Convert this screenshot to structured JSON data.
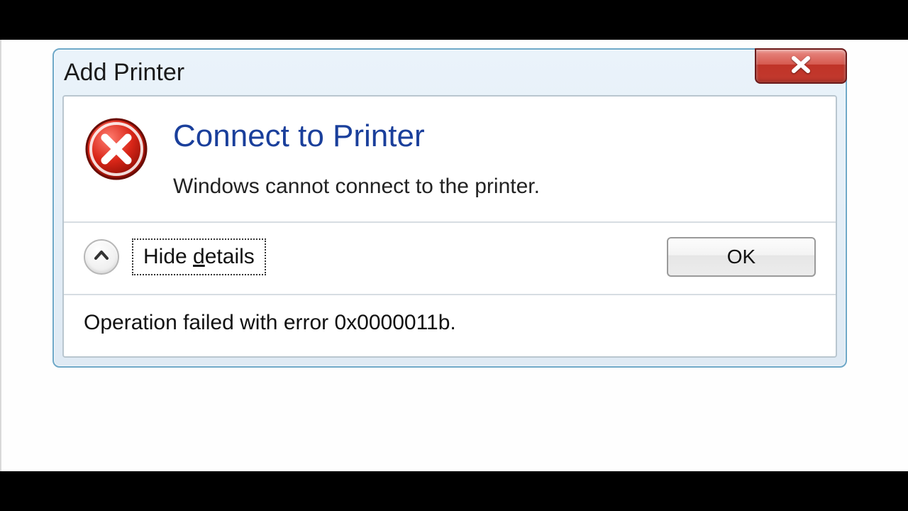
{
  "dialog": {
    "title": "Add Printer",
    "heading": "Connect to Printer",
    "message": "Windows cannot connect to the printer.",
    "toggle_details_label": "Hide details",
    "ok_label": "OK",
    "details_text": "Operation failed with error 0x0000011b."
  }
}
